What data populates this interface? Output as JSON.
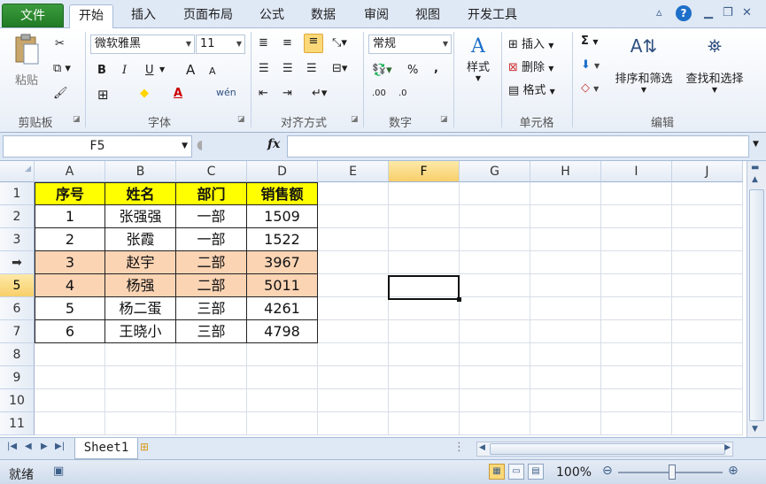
{
  "ribbon_tabs": [
    "文件",
    "开始",
    "插入",
    "页面布局",
    "公式",
    "数据",
    "审阅",
    "视图",
    "开发工具"
  ],
  "active_tab": "开始",
  "clipboard": {
    "paste": "粘贴",
    "group": "剪贴板"
  },
  "font": {
    "name": "微软雅黑",
    "size": "11",
    "group": "字体",
    "bold": "B",
    "italic": "I",
    "underline": "U",
    "grow": "A",
    "shrink": "A",
    "fill_color": "◆",
    "font_color": "A",
    "phonetic": "wén"
  },
  "alignment": {
    "group": "对齐方式"
  },
  "number": {
    "format": "常规",
    "group": "数字",
    "percent": "%",
    "comma": ",",
    "inc_decimal": ".00",
    "dec_decimal": ".0"
  },
  "styles": {
    "label": "样式"
  },
  "cells": {
    "insert": "插入",
    "delete": "删除",
    "format": "格式",
    "group": "单元格"
  },
  "editing": {
    "sum": "Σ",
    "sort_filter": "排序和筛选",
    "find_select": "查找和选择",
    "group": "编辑"
  },
  "formula_bar": {
    "name_box": "F5",
    "fx": "fx",
    "value": ""
  },
  "columns": [
    "A",
    "B",
    "C",
    "D",
    "E",
    "F",
    "G",
    "H",
    "I",
    "J"
  ],
  "selected_column": "F",
  "rows": [
    "1",
    "2",
    "3",
    "➡",
    "5",
    "6",
    "7",
    "8",
    "9",
    "10",
    "11"
  ],
  "selected_row": "5",
  "table": {
    "headers": [
      "序号",
      "姓名",
      "部门",
      "销售额"
    ],
    "data": [
      [
        "1",
        "张强强",
        "一部",
        "1509"
      ],
      [
        "2",
        "张霞",
        "一部",
        "1522"
      ],
      [
        "3",
        "赵宇",
        "二部",
        "3967"
      ],
      [
        "4",
        "杨强",
        "二部",
        "5011"
      ],
      [
        "5",
        "杨二蛋",
        "三部",
        "4261"
      ],
      [
        "6",
        "王晓小",
        "三部",
        "4798"
      ]
    ],
    "highlight_rows": [
      2,
      3
    ],
    "highlight_color": "#fbd4b4",
    "header_color": "#ffff00"
  },
  "sheet_tabs": [
    "Sheet1"
  ],
  "status": {
    "ready": "就绪",
    "zoom": "100%"
  },
  "colors": {
    "file_tab": "#2d8a31",
    "accent": "#1d6fc9",
    "selection": "#f8cf6a"
  }
}
